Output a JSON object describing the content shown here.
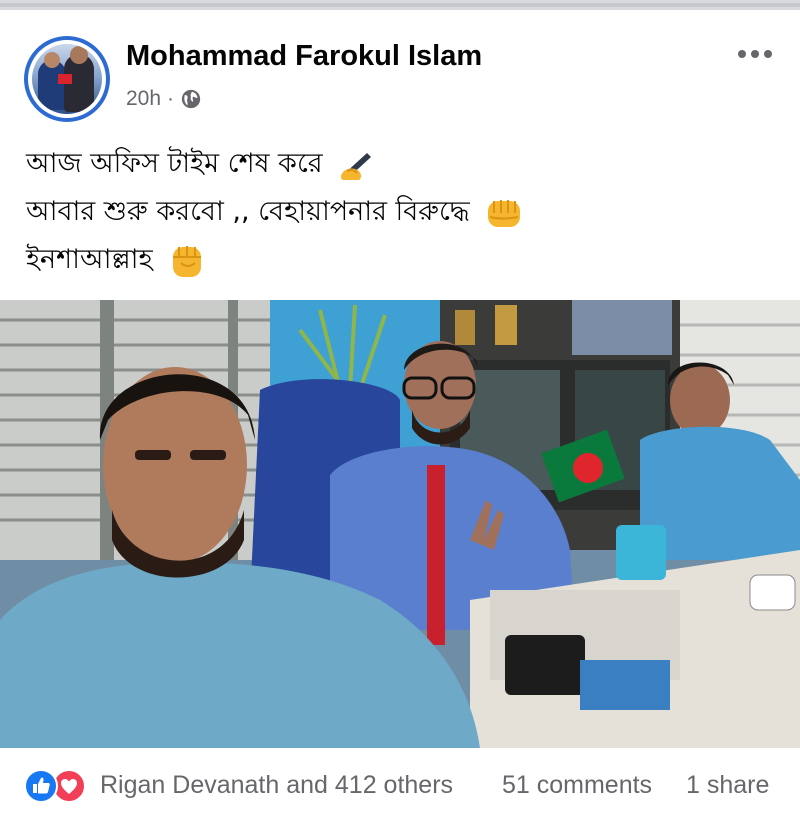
{
  "post": {
    "author_name": "Mohammad Farokul Islam",
    "time_ago": "20h",
    "separator": "·",
    "privacy_icon": "globe-icon",
    "menu_icon": "more-options-icon",
    "text_lines": [
      "আজ অফিস টাইম শেষ করে",
      "আবার শুরু করবো ,, বেহায়াপনার বিরুদ্ধে",
      "ইনশাআল্লাহ"
    ],
    "emoji_icons": [
      "writing-hand-emoji",
      "oncoming-fist-emoji",
      "raised-fist-emoji"
    ]
  },
  "photo": {
    "subject": "post-photo",
    "flag_colors": {
      "green": "#0a7a3c",
      "red": "#e0262d"
    }
  },
  "reactions": {
    "icons": [
      "like-icon",
      "love-icon"
    ],
    "summary": "Rigan Devanath and 412 others",
    "comments": "51 comments",
    "shares": "1 share"
  },
  "colors": {
    "brand_blue": "#1877f2",
    "love_red": "#f33e58",
    "secondary_text": "#65676b",
    "primary_text": "#050505"
  }
}
